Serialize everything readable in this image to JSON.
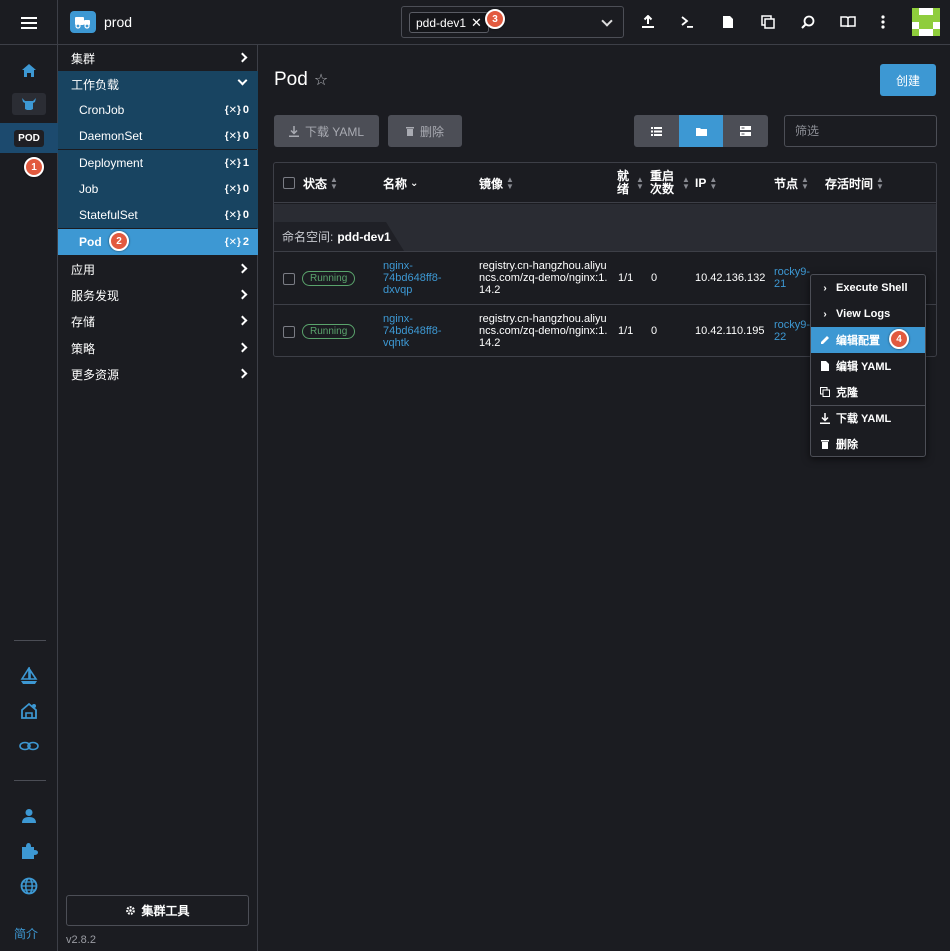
{
  "header": {
    "cluster_name": "prod",
    "namespace_chip": "pdd-dev1",
    "namespace_chip_remove": "✕"
  },
  "rail": {
    "pod_badge": "POD",
    "footer_link": "简介"
  },
  "nav": {
    "groups": [
      {
        "label": "集群"
      },
      {
        "label": "工作负载"
      },
      {
        "label": "应用"
      },
      {
        "label": "服务发现"
      },
      {
        "label": "存储"
      },
      {
        "label": "策略"
      },
      {
        "label": "更多资源"
      }
    ],
    "workloads": [
      {
        "label": "CronJob",
        "count": "0"
      },
      {
        "label": "DaemonSet",
        "count": "0"
      },
      {
        "label": "Deployment",
        "count": "1"
      },
      {
        "label": "Job",
        "count": "0"
      },
      {
        "label": "StatefulSet",
        "count": "0"
      },
      {
        "label": "Pod",
        "count": "2"
      }
    ],
    "count_prefix": "{✕}",
    "cluster_tools": "集群工具",
    "version": "v2.8.2"
  },
  "main": {
    "title": "Pod",
    "create_button": "创建",
    "download_yaml": "下载 YAML",
    "delete": "删除",
    "filter_placeholder": "筛选"
  },
  "table": {
    "headers": {
      "status": "状态",
      "name": "名称",
      "image": "镜像",
      "ready": "就绪",
      "restarts": "重启次数",
      "ip": "IP",
      "node": "节点",
      "age": "存活时间"
    },
    "group_label": "命名空间:",
    "group_value": "pdd-dev1",
    "rows": [
      {
        "status": "Running",
        "name": [
          "nginx-",
          "74bd648ff8-",
          "dxvqp"
        ],
        "image": [
          "registry.cn-hangzhou.aliyu",
          "ncs.com/zq-demo/nginx:1.",
          "14.2"
        ],
        "ready": "1/1",
        "restarts": "0",
        "ip": "10.42.136.132",
        "node": [
          "rocky9-",
          "21"
        ]
      },
      {
        "status": "Running",
        "name": [
          "nginx-",
          "74bd648ff8-",
          "vqhtk"
        ],
        "image": [
          "registry.cn-hangzhou.aliyu",
          "ncs.com/zq-demo/nginx:1.",
          "14.2"
        ],
        "ready": "1/1",
        "restarts": "0",
        "ip": "10.42.110.195",
        "node": [
          "rocky9-",
          "22"
        ]
      }
    ]
  },
  "context_menu": {
    "execute_shell": "Execute Shell",
    "view_logs": "View Logs",
    "edit_config": "编辑配置",
    "edit_yaml": "编辑 YAML",
    "clone": "克隆",
    "download_yaml": "下载 YAML",
    "delete": "删除"
  },
  "markers": [
    "1",
    "2",
    "3",
    "4"
  ],
  "colors": {
    "accent": "#3d98d3",
    "nav_open_bg": "#184461",
    "running": "#5aa36c",
    "marker": "#e25a3f"
  }
}
